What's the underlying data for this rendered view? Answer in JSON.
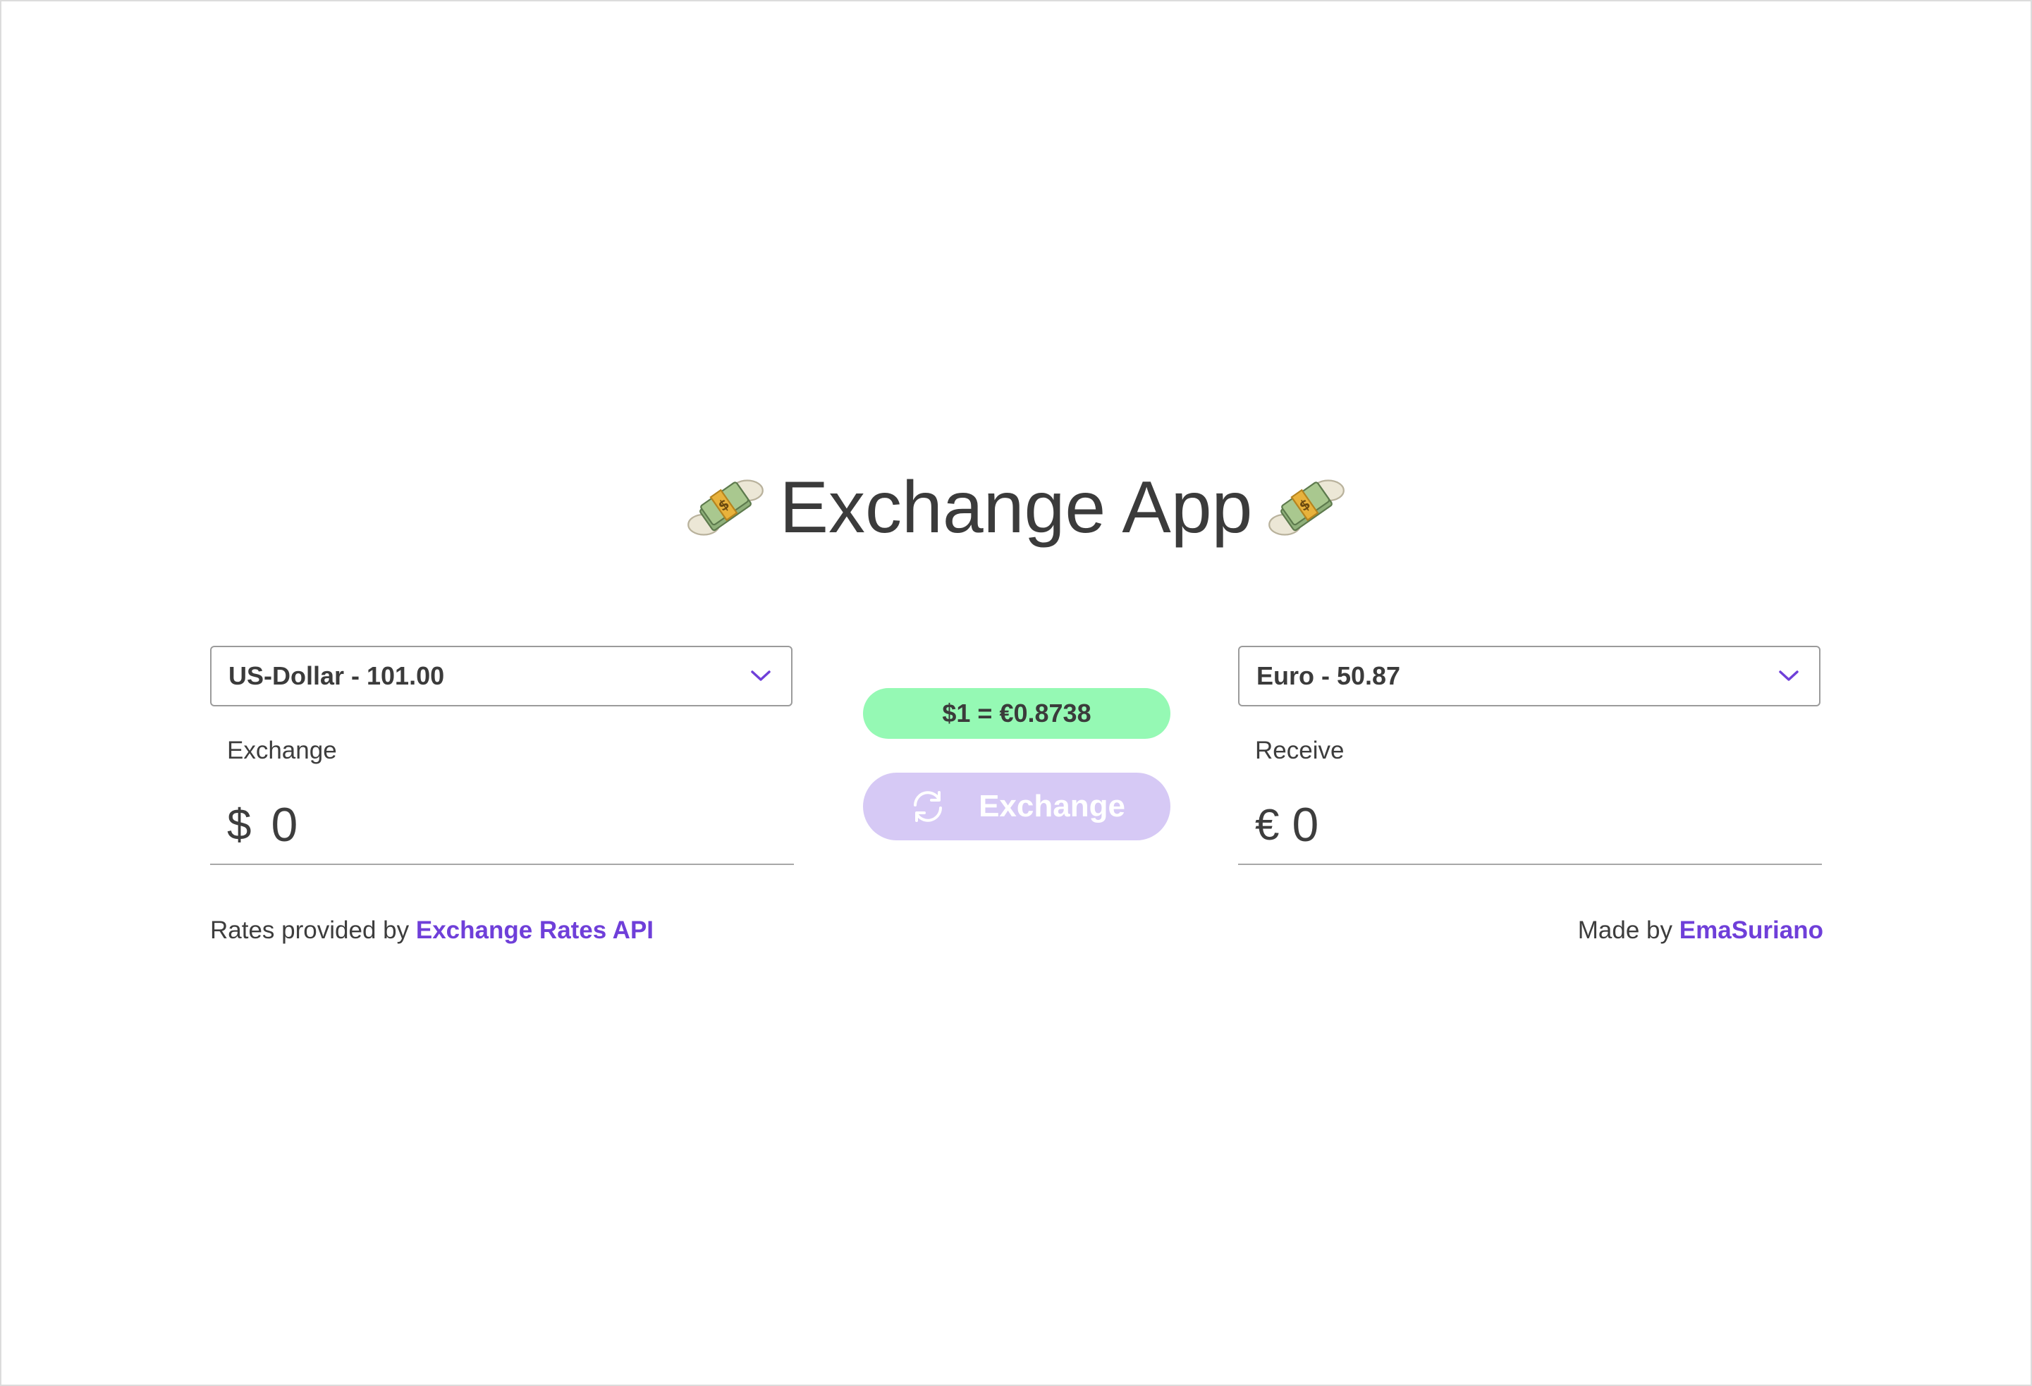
{
  "header": {
    "title": "Exchange App",
    "icon": "money-with-wings-icon"
  },
  "from": {
    "select_value": "US-Dollar - 101.00",
    "label": "Exchange",
    "symbol": "$",
    "amount": "0"
  },
  "to": {
    "select_value": "Euro - 50.87",
    "label": "Receive",
    "symbol": "€",
    "amount": "0"
  },
  "rate": {
    "text": "$1 = €0.8738"
  },
  "exchange_button": {
    "label": "Exchange",
    "icon": "sync-icon"
  },
  "footer": {
    "left_prefix": "Rates provided by",
    "left_link": "Exchange Rates API",
    "right_prefix": "Made by",
    "right_link": "EmaSuriano"
  },
  "colors": {
    "accent": "#6f3fd9",
    "rate_badge": "#95f9b4",
    "button_bg": "#d6c9f5",
    "text": "#3d3d3d"
  }
}
